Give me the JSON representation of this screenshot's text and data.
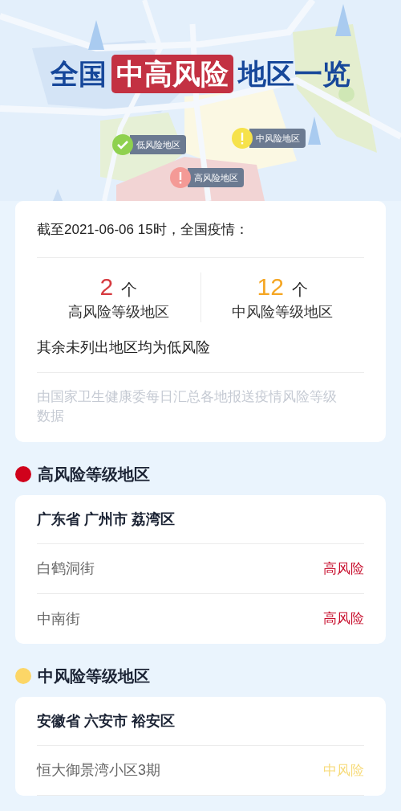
{
  "banner": {
    "title": [
      {
        "text": "全国",
        "highlight": false
      },
      {
        "text": "中高风险",
        "highlight": true
      },
      {
        "text": "地区一览",
        "highlight": false
      }
    ],
    "pins": [
      {
        "label": "低风险地区",
        "kind": "low"
      },
      {
        "label": "中风险地区",
        "kind": "mid"
      },
      {
        "label": "高风险地区",
        "kind": "high"
      }
    ]
  },
  "summary": {
    "as_of": "截至2021-06-06 15时，全国疫情：",
    "stats": [
      {
        "count": "2",
        "unit": "个",
        "label": "高风险等级地区",
        "color": "#d63a3f"
      },
      {
        "count": "12",
        "unit": "个",
        "label": "中风险等级地区",
        "color": "#f5a623"
      }
    ],
    "note": "其余未列出地区均为低风险",
    "source": "由国家卫生健康委每日汇总各地报送疫情风险等级数据"
  },
  "sections": [
    {
      "title": "高风险等级地区",
      "color": "#d0021b",
      "groups": [
        {
          "region": "广东省 广州市 荔湾区",
          "rows": [
            {
              "name": "白鹤洞街",
              "level": "高风险",
              "color": "#c8102e"
            },
            {
              "name": "中南街",
              "level": "高风险",
              "color": "#c8102e"
            }
          ]
        }
      ]
    },
    {
      "title": "中风险等级地区",
      "color": "#fcd667",
      "groups": [
        {
          "region": "安徽省 六安市 裕安区",
          "rows": [
            {
              "name": "恒大御景湾小区3期",
              "level": "中风险",
              "color": "#f7db7a"
            }
          ]
        }
      ]
    }
  ]
}
